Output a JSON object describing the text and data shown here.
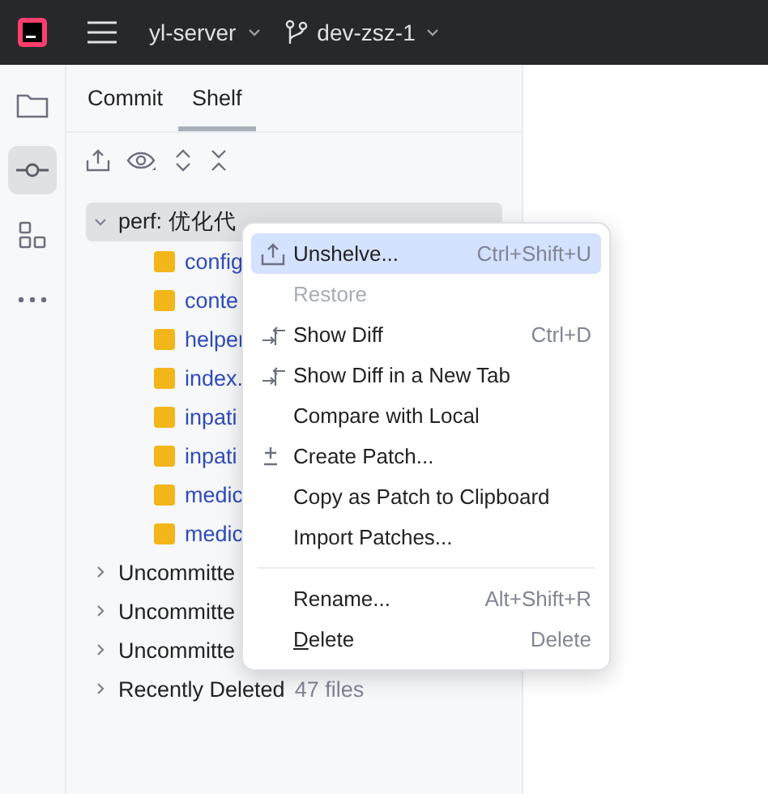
{
  "titlebar": {
    "project": "yl-server",
    "branch": "dev-zsz-1"
  },
  "tabs": [
    {
      "label": "Commit",
      "selected": false
    },
    {
      "label": "Shelf",
      "selected": true
    }
  ],
  "tree": [
    {
      "kind": "group",
      "label": "perf: 优化代",
      "expanded": true,
      "selected": true,
      "children": [
        {
          "kind": "file",
          "label": "config"
        },
        {
          "kind": "file",
          "label": "conte"
        },
        {
          "kind": "file",
          "label": "helper"
        },
        {
          "kind": "file",
          "label": "index."
        },
        {
          "kind": "file",
          "label": "inpati"
        },
        {
          "kind": "file",
          "label": "inpati"
        },
        {
          "kind": "file",
          "label": "medic"
        },
        {
          "kind": "file",
          "label": "medic"
        }
      ]
    },
    {
      "kind": "group",
      "label": "Uncommitte",
      "expanded": false,
      "selected": false
    },
    {
      "kind": "group",
      "label": "Uncommitte",
      "expanded": false,
      "selected": false
    },
    {
      "kind": "group",
      "label": "Uncommitte",
      "expanded": false,
      "selected": false
    },
    {
      "kind": "group",
      "label": "Recently Deleted",
      "meta": "47 files",
      "expanded": false,
      "selected": false
    }
  ],
  "menu": [
    {
      "kind": "unshelve",
      "label": "Unshelve...",
      "shortcut": "Ctrl+Shift+U",
      "selected": true,
      "disabled": false
    },
    {
      "kind": "plain",
      "label": "Restore",
      "selected": false,
      "disabled": true
    },
    {
      "kind": "diff",
      "label": "Show Diff",
      "shortcut": "Ctrl+D",
      "selected": false,
      "disabled": false
    },
    {
      "kind": "diff",
      "label": "Show Diff in a New Tab",
      "selected": false,
      "disabled": false
    },
    {
      "kind": "plain",
      "label": "Compare with Local",
      "selected": false,
      "disabled": false
    },
    {
      "kind": "patch",
      "label": "Create Patch...",
      "selected": false,
      "disabled": false
    },
    {
      "kind": "plain",
      "label": "Copy as Patch to Clipboard",
      "selected": false,
      "disabled": false
    },
    {
      "kind": "plain",
      "label": "Import Patches...",
      "selected": false,
      "disabled": false
    },
    {
      "kind": "separator"
    },
    {
      "kind": "plain",
      "label": "Rename...",
      "shortcut": "Alt+Shift+R",
      "selected": false,
      "disabled": false
    },
    {
      "kind": "plain",
      "label": "Delete",
      "shortcut": "Delete",
      "selected": false,
      "disabled": false,
      "mnemonic": true
    }
  ]
}
